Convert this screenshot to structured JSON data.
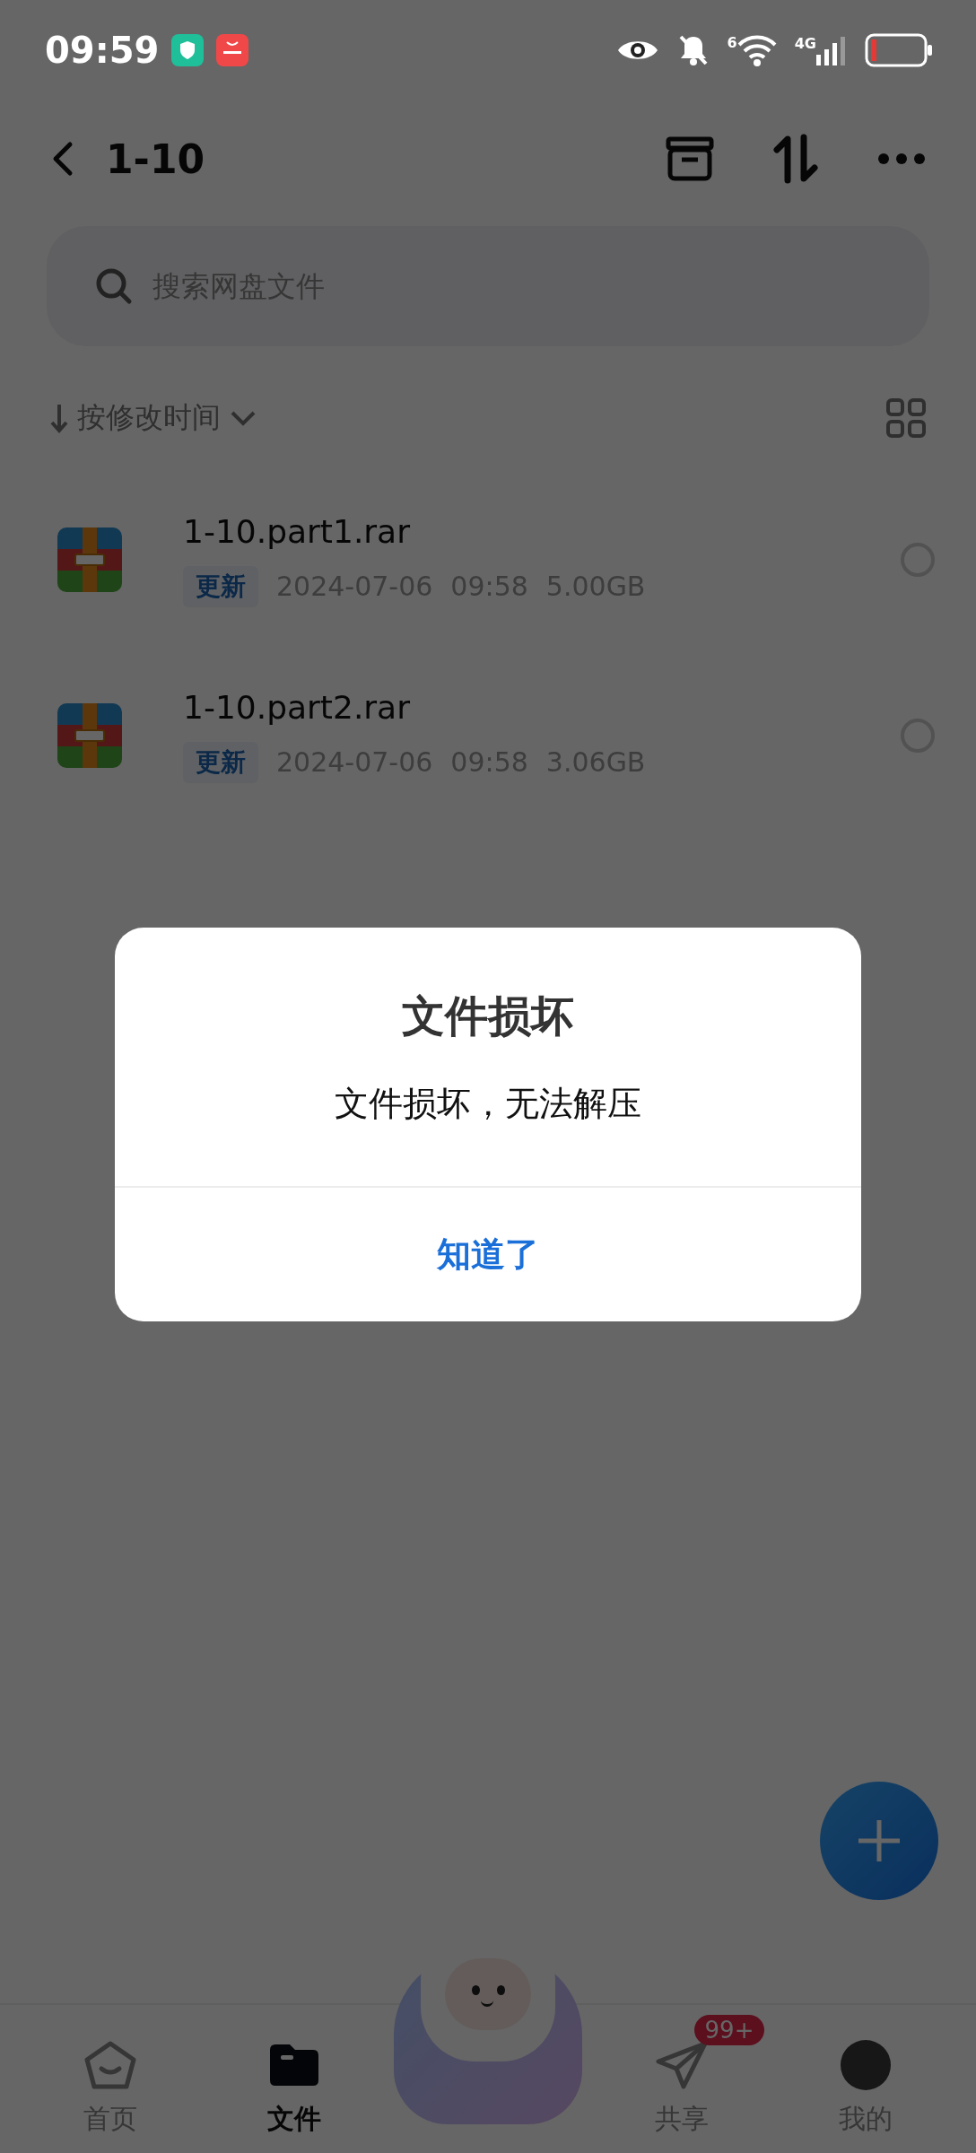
{
  "status_bar": {
    "time": "09:59",
    "wifi_label": "6",
    "network_label": "4G"
  },
  "header": {
    "title": "1-10"
  },
  "search": {
    "placeholder": "搜索网盘文件"
  },
  "sort": {
    "label": "按修改时间"
  },
  "files": [
    {
      "name": "1-10.part1.rar",
      "tag": "更新",
      "date": "2024-07-06",
      "time": "09:58",
      "size": "5.00GB",
      "selected": false
    },
    {
      "name": "1-10.part2.rar",
      "tag": "更新",
      "date": "2024-07-06",
      "time": "09:58",
      "size": "3.06GB",
      "selected": false
    }
  ],
  "dialog": {
    "title": "文件损坏",
    "message": "文件损坏，无法解压",
    "button": "知道了"
  },
  "nav": [
    {
      "kind": "home",
      "label": "首页",
      "selected": false
    },
    {
      "kind": "files",
      "label": "文件",
      "selected": true
    },
    {
      "kind": "mascot"
    },
    {
      "kind": "share",
      "label": "共享",
      "selected": false,
      "badge": "99+"
    },
    {
      "kind": "me",
      "label": "我的",
      "selected": false
    }
  ]
}
